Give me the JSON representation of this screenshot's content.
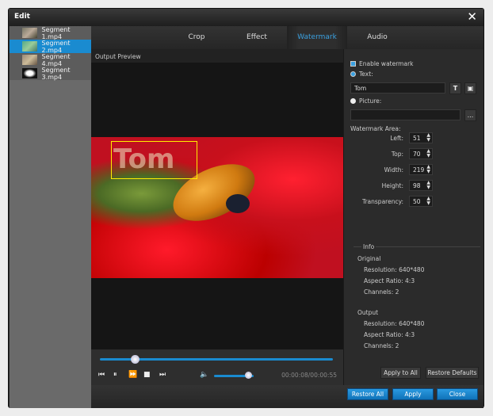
{
  "window": {
    "title": "Edit",
    "close_icon": "close-icon"
  },
  "segments": [
    {
      "label": "Segment 1.mp4",
      "selected": false
    },
    {
      "label": "Segment 2.mp4",
      "selected": true
    },
    {
      "label": "Segment 4.mp4",
      "selected": false
    },
    {
      "label": "Segment 3.mp4",
      "selected": false
    }
  ],
  "tabs": [
    {
      "label": "Crop"
    },
    {
      "label": "Effect"
    },
    {
      "label": "Watermark",
      "active": true
    },
    {
      "label": "Audio"
    }
  ],
  "preview": {
    "label": "Output Preview",
    "watermark_text": "Tom",
    "progress": 0.15,
    "volume": 0.85,
    "time": "00:00:08/00:00:55"
  },
  "watermark": {
    "enable_label": "Enable watermark",
    "enabled": true,
    "text_label": "Text:",
    "text_value": "Tom",
    "picture_label": "Picture:",
    "picture_value": "",
    "browse_label": "...",
    "area_label": "Watermark Area:",
    "fields": [
      {
        "label": "Left:",
        "value": "51"
      },
      {
        "label": "Top:",
        "value": "70"
      },
      {
        "label": "Width:",
        "value": "219"
      },
      {
        "label": "Height:",
        "value": "98"
      },
      {
        "label": "Transparency:",
        "value": "50"
      }
    ]
  },
  "info": {
    "title": "Info",
    "original": {
      "label": "Original",
      "resolution": "Resolution: 640*480",
      "aspect": "Aspect Ratio: 4:3",
      "channels": "Channels: 2"
    },
    "output": {
      "label": "Output",
      "resolution": "Resolution: 640*480",
      "aspect": "Aspect Ratio: 4:3",
      "channels": "Channels: 2"
    }
  },
  "buttons": {
    "apply_to_all": "Apply to All",
    "restore_defaults": "Restore Defaults",
    "restore_all": "Restore All",
    "apply": "Apply",
    "close": "Close"
  },
  "colors": {
    "accent": "#1a8bd0"
  }
}
